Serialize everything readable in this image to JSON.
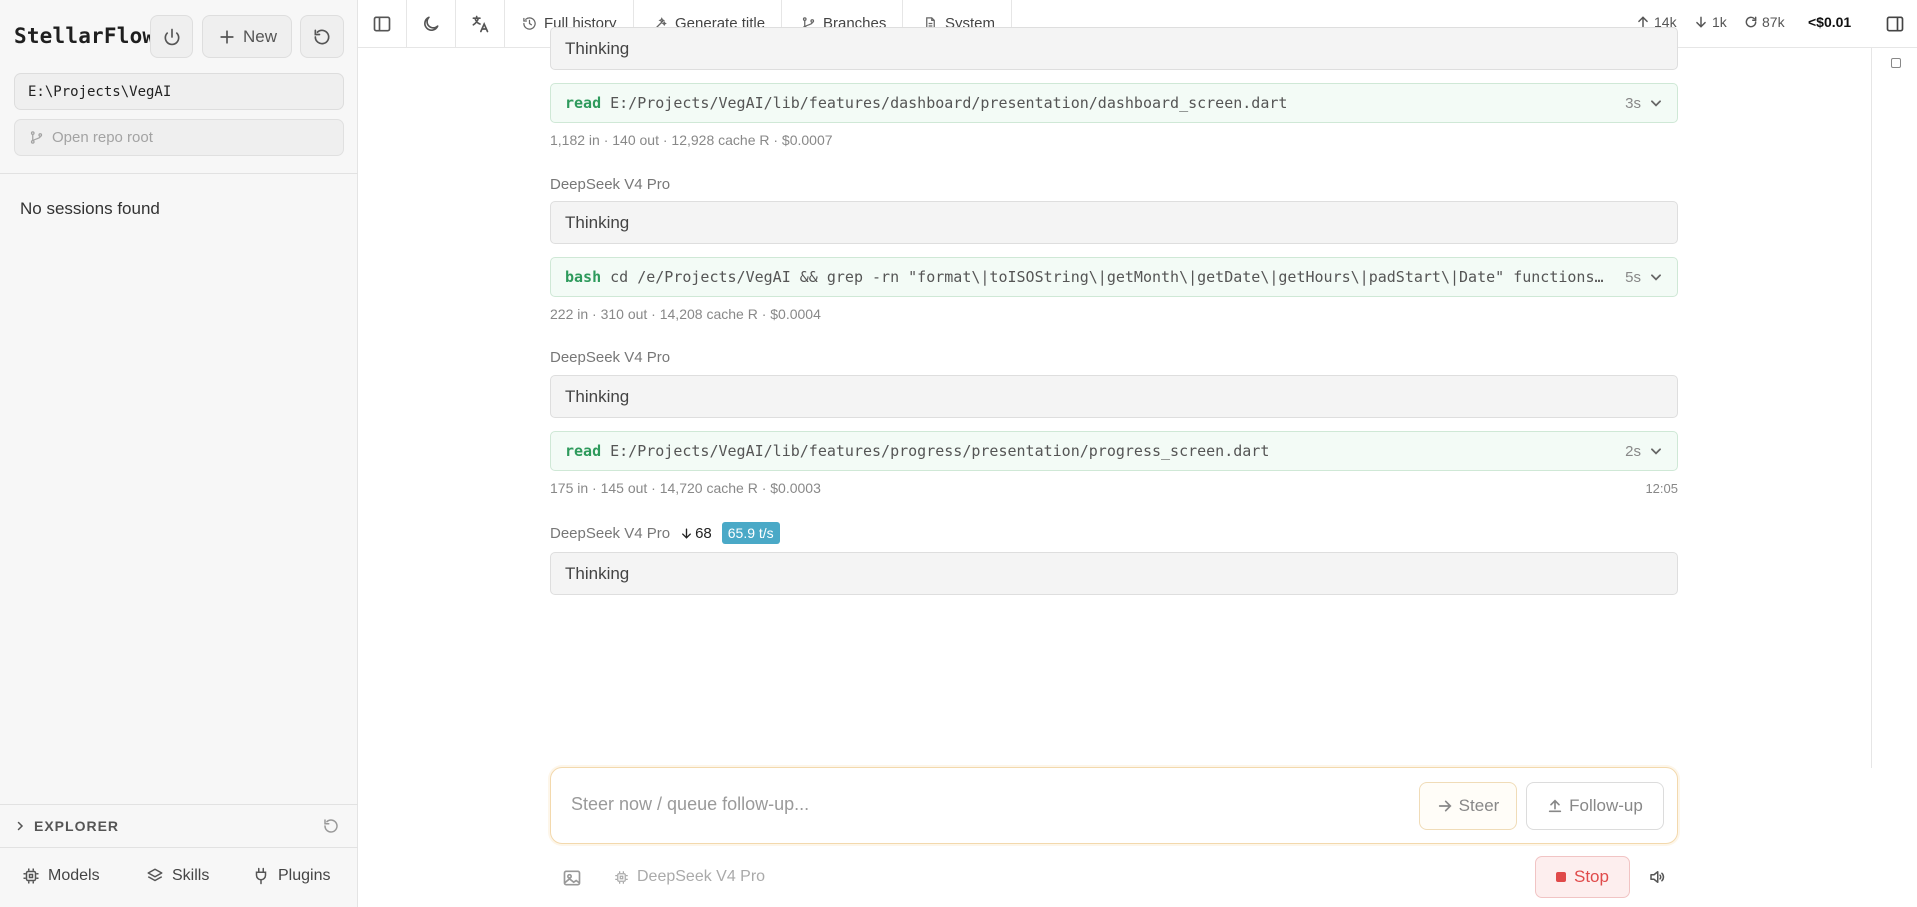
{
  "sidebar": {
    "brand": "StellarFlow",
    "new_label": "New",
    "project_path": "E:\\Projects\\VegAI",
    "open_repo_label": "Open repo root",
    "empty_sessions": "No sessions found",
    "explorer_label": "EXPLORER",
    "bottom": {
      "models": "Models",
      "skills": "Skills",
      "plugins": "Plugins"
    }
  },
  "topbar": {
    "full_history": "Full history",
    "generate_title": "Generate title",
    "branches": "Branches",
    "system": "System",
    "tokens_up": "14k",
    "tokens_down": "1k",
    "cache": "87k",
    "cost": "<$0.01"
  },
  "conversation": {
    "partial_thinking": "Thinking",
    "steps": [
      {
        "tool": "read",
        "arg": "E:/Projects/VegAI/lib/features/dashboard/presentation/dashboard_screen.dart",
        "duration": "3s",
        "meta": "1,182 in · 140 out · 12,928 cache R · $0.0007"
      },
      {
        "model": "DeepSeek V4 Pro",
        "thinking": "Thinking",
        "tool": "bash",
        "arg": "cd /e/Projects/VegAI && grep -rn \"format\\|toISOString\\|getMonth\\|getDate\\|getHours\\|padStart\\|Date\" functions/src/index.ts",
        "duration": "5s",
        "meta": "222 in · 310 out · 14,208 cache R · $0.0004"
      },
      {
        "model": "DeepSeek V4 Pro",
        "thinking": "Thinking",
        "tool": "read",
        "arg": "E:/Projects/VegAI/lib/features/progress/presentation/progress_screen.dart",
        "duration": "2s",
        "meta": "175 in · 145 out · 14,720 cache R · $0.0003",
        "time": "12:05"
      }
    ],
    "streaming": {
      "model": "DeepSeek V4 Pro",
      "tokens_down": "68",
      "tps": "65.9 t/s",
      "thinking": "Thinking"
    }
  },
  "composer": {
    "placeholder": "Steer now / queue follow-up...",
    "steer_label": "Steer",
    "follow_up_label": "Follow-up",
    "model": "DeepSeek V4 Pro",
    "stop_label": "Stop"
  },
  "colors": {
    "tool_name": "#2e9a5c",
    "tps_badge": "#4aa9c7",
    "stop": "#e04a4a"
  }
}
